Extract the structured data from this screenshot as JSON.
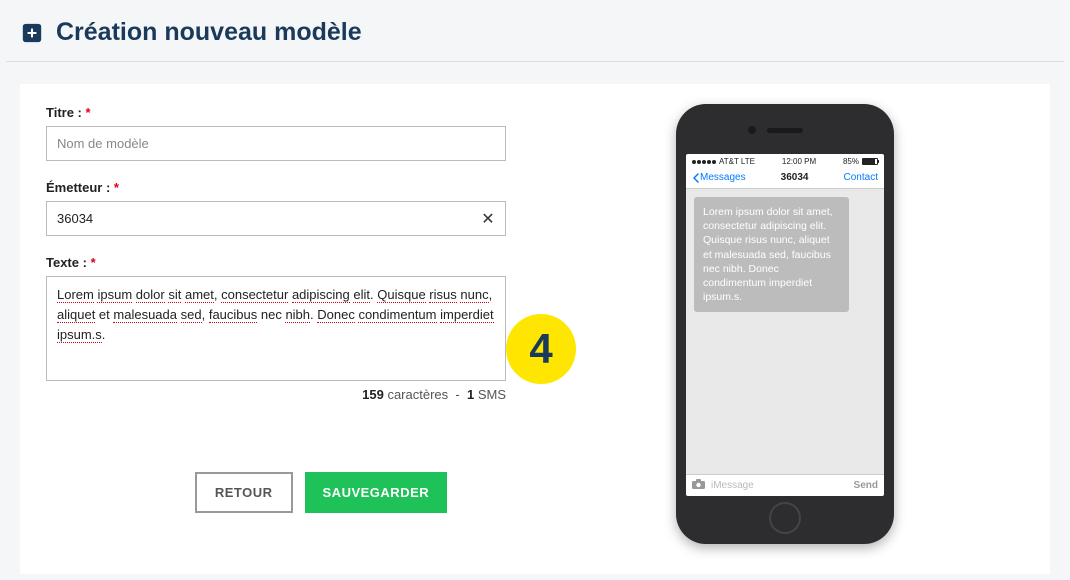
{
  "page_title": "Création nouveau modèle",
  "form": {
    "title_label": "Titre :",
    "title_placeholder": "Nom de modèle",
    "title_value": "",
    "sender_label": "Émetteur :",
    "sender_value": "36034",
    "text_label": "Texte :",
    "text_value": "Lorem ipsum dolor sit amet, consectetur adipiscing elit. Quisque risus nunc, aliquet et malesuada sed, faucibus nec nibh. Donec condimentum imperdiet ipsum.s."
  },
  "counter": {
    "char_count": "159",
    "char_label": "caractères",
    "sep": "-",
    "sms_count": "1",
    "sms_label": "SMS"
  },
  "step_number": "4",
  "actions": {
    "back": "Retour",
    "save": "Sauvegarder"
  },
  "phone": {
    "carrier": "AT&T LTE",
    "time": "12:00 PM",
    "battery_pct": "85%",
    "nav_back": "Messages",
    "nav_title": "36034",
    "nav_contact": "Contact",
    "message": "Lorem ipsum dolor sit amet, consectetur adipiscing elit. Quisque risus nunc, aliquet et malesuada sed, faucibus nec nibh. Donec condimentum imperdiet ipsum.s.",
    "input_placeholder": "iMessage",
    "send_label": "Send"
  }
}
